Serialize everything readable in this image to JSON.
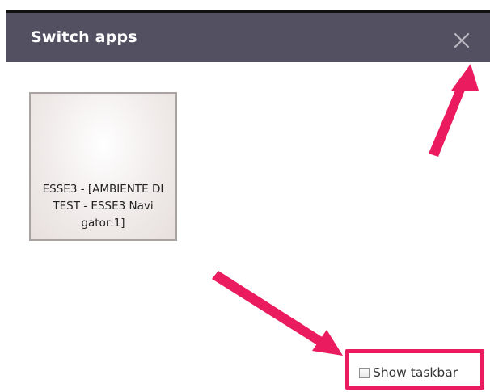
{
  "dialog": {
    "title": "Switch apps",
    "close_icon": "close-icon"
  },
  "apps": [
    {
      "label": "ESSE3 - [AMBIENTE DI TEST - ESSE3 Navi gator:1]"
    }
  ],
  "taskbar_option": {
    "label": "Show taskbar",
    "checked": false
  },
  "annotations": {
    "arrow_color": "#ea1c5f"
  },
  "colors": {
    "titlebar": "#535061",
    "highlight": "#ea1c5f"
  }
}
